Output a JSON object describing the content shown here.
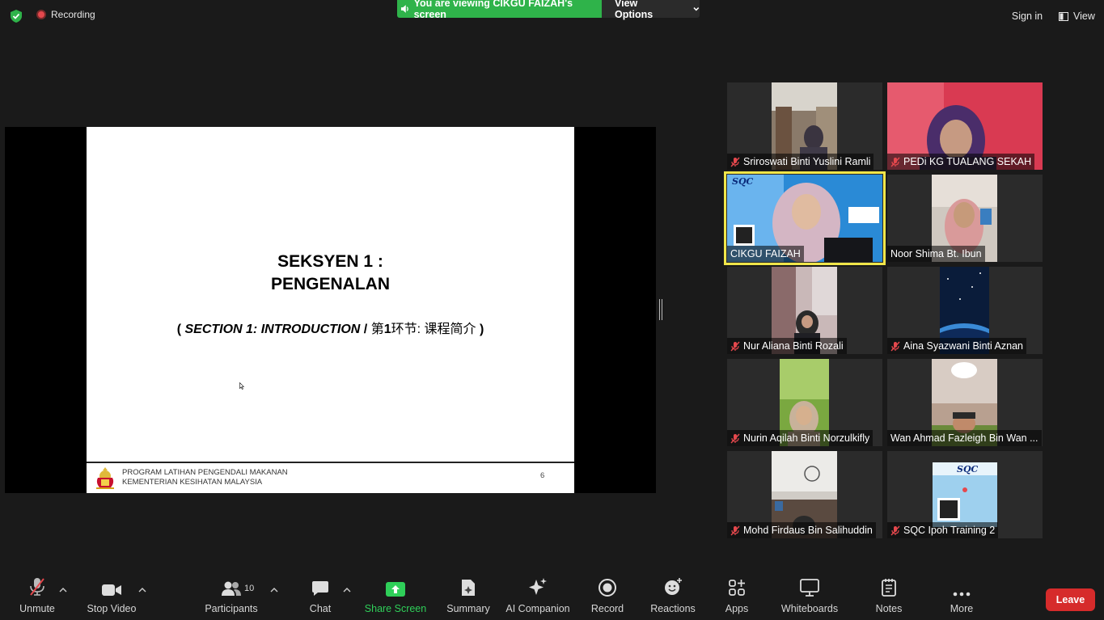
{
  "topbar": {
    "recording_label": "Recording",
    "viewing_banner": "You are viewing CIKGU FAIZAH's screen",
    "view_options_label": "View Options",
    "signin_label": "Sign in",
    "view_label": "View"
  },
  "slide": {
    "title_line1": "SEKSYEN 1 :",
    "title_line2": "PENGENALAN",
    "subtitle_open": "( ",
    "subtitle_en": "SECTION 1: INTRODUCTION",
    "subtitle_sep": " / ",
    "subtitle_zh_a": "第",
    "subtitle_zh_num": "1",
    "subtitle_zh_b": "环节: 课程简介",
    "subtitle_close": " )",
    "footer_line1": "PROGRAM LATIHAN PENGENDALI MAKANAN",
    "footer_line2": "KEMENTERIAN KESIHATAN MALAYSIA",
    "page_number": "6"
  },
  "participants": [
    {
      "name": "Sriroswati Binti Yuslini Ramli",
      "muted": true
    },
    {
      "name": "PEDi KG TUALANG SEKAH",
      "muted": true
    },
    {
      "name": "CIKGU FAIZAH",
      "muted": false
    },
    {
      "name": "Noor Shima Bt. Ibun",
      "muted": false
    },
    {
      "name": "Nur Aliana Binti Rozali",
      "muted": true
    },
    {
      "name": "Aina Syazwani Binti Aznan",
      "muted": true
    },
    {
      "name": "Nurin Aqilah Binti Norzulkifly",
      "muted": true
    },
    {
      "name": "Wan Ahmad Fazleigh Bin Wan ...",
      "muted": false
    },
    {
      "name": "Mohd Firdaus Bin Salihuddin",
      "muted": true
    },
    {
      "name": "SQC Ipoh Training 2",
      "muted": true
    }
  ],
  "toolbar": {
    "unmute": "Unmute",
    "stop_video": "Stop Video",
    "participants": "Participants",
    "participants_count": "10",
    "chat": "Chat",
    "share_screen": "Share Screen",
    "summary": "Summary",
    "ai_companion": "AI Companion",
    "record": "Record",
    "reactions": "Reactions",
    "apps": "Apps",
    "whiteboards": "Whiteboards",
    "notes": "Notes",
    "more": "More",
    "leave": "Leave"
  },
  "colors": {
    "banner_green": "#2fb34a",
    "leave_red": "#d62b2b",
    "active_speaker": "#f0e64a",
    "share_green": "#2fcf59"
  }
}
